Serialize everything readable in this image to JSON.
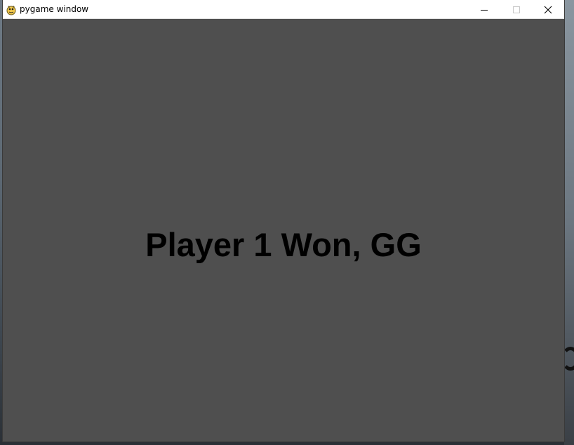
{
  "window": {
    "title": "pygame window",
    "controls": [
      "minimize",
      "maximize",
      "close"
    ]
  },
  "game": {
    "message": "Player 1 Won, GG",
    "background_color": "#4f4f4f",
    "text_color": "#000000"
  },
  "icons": {
    "app": "pygame-snake-icon",
    "minimize": "minimize-icon",
    "maximize": "maximize-icon",
    "close": "close-icon"
  }
}
